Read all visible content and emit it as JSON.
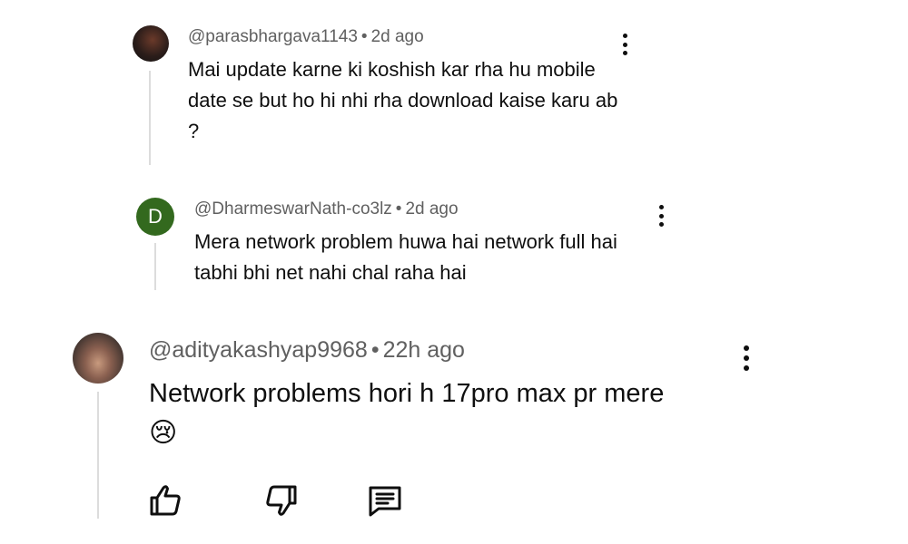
{
  "comments": [
    {
      "handle": "@parasbhargava1143",
      "time": "2d ago",
      "text": "Mai update karne ki koshish kar rha hu mobile date se but ho hi nhi rha download kaise karu ab ?",
      "avatar_color": "#2b1d1a"
    },
    {
      "handle": "@DharmeswarNath-co3lz",
      "time": "2d ago",
      "text": "Mera network problem huwa hai network full hai tabhi bhi net nahi chal raha hai",
      "avatar_letter": "D",
      "avatar_color": "#33691e"
    },
    {
      "handle": "@adityakashyap9968",
      "time": "22h ago",
      "text": "Network problems hori h 17pro max pr mere",
      "emoji": "😢",
      "avatar_color": "#7a5a4a"
    }
  ],
  "meta_separator": "•",
  "icons": {
    "more": "more-vert-icon",
    "like": "thumbs-up-icon",
    "dislike": "thumbs-down-icon",
    "reply": "reply-comment-icon"
  }
}
